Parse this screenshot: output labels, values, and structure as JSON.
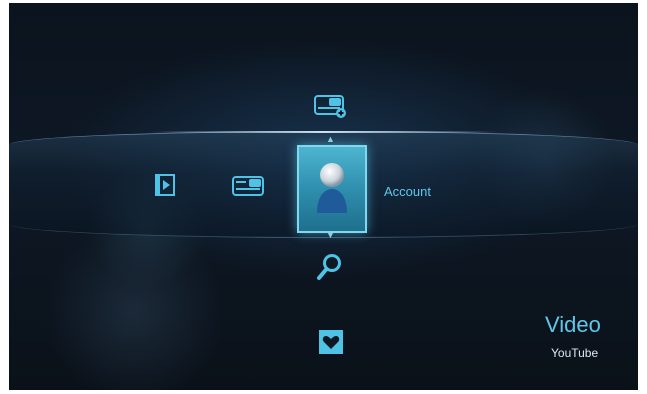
{
  "menu": {
    "selected_label": "Account",
    "items": [
      {
        "icon": "video-file-icon"
      },
      {
        "icon": "youtube-logo-icon"
      },
      {
        "icon": "user-account-icon",
        "label": "Account",
        "selected": true
      },
      {
        "icon": "youtube-add-icon"
      },
      {
        "icon": "search-icon"
      },
      {
        "icon": "favorite-heart-icon"
      }
    ]
  },
  "caption": {
    "title": "Video",
    "subtitle": "YouTube"
  },
  "colors": {
    "accent": "#4ec3e6",
    "tile": "#2f8fae",
    "background": "#0b131d"
  }
}
